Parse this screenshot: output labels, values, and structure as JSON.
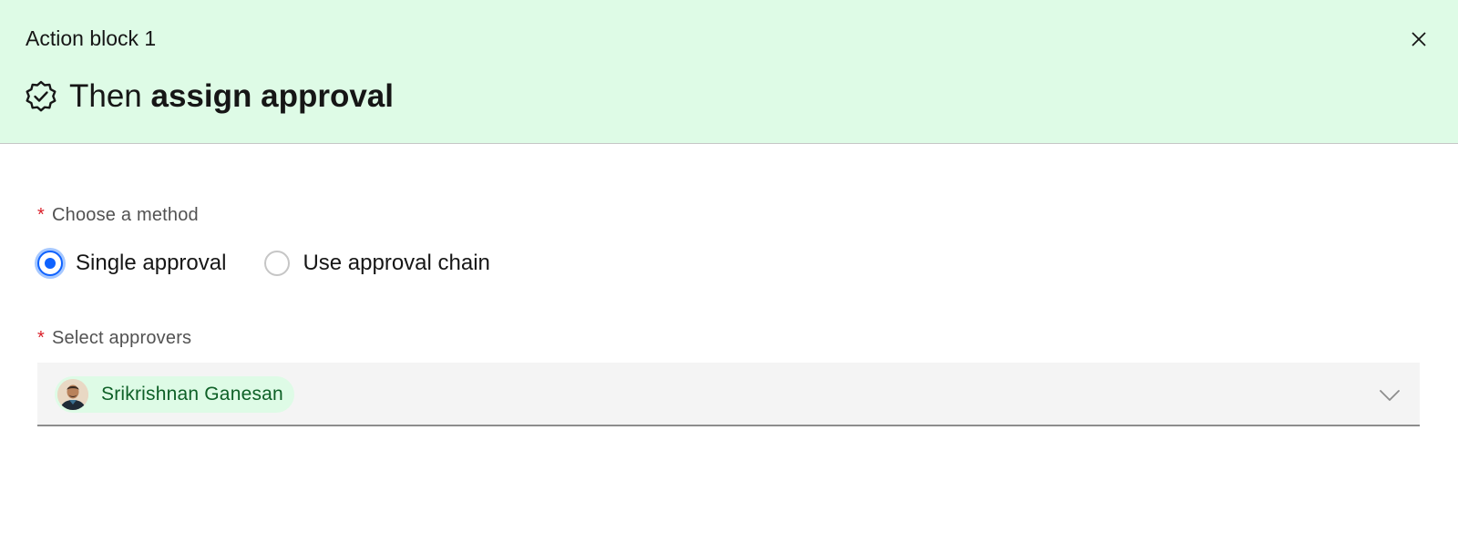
{
  "header": {
    "block_label": "Action block 1",
    "title_prefix": "Then ",
    "title_bold": "assign approval",
    "title_icon": "certificate-check-icon",
    "close_icon": "close-icon",
    "background_color": "#defbe6"
  },
  "method": {
    "required_mark": "*",
    "label": "Choose a method",
    "options": [
      {
        "label": "Single approval",
        "selected": true
      },
      {
        "label": "Use approval chain",
        "selected": false
      }
    ]
  },
  "approvers": {
    "required_mark": "*",
    "label": "Select approvers",
    "selected_tags": [
      {
        "name": "Srikrishnan Ganesan",
        "icon": "avatar"
      }
    ],
    "dropdown_icon": "chevron-down-icon"
  },
  "colors": {
    "accent": "#0f62fe",
    "required": "#da1e28",
    "tag_background": "#defbe6",
    "tag_text": "#0e6027"
  }
}
